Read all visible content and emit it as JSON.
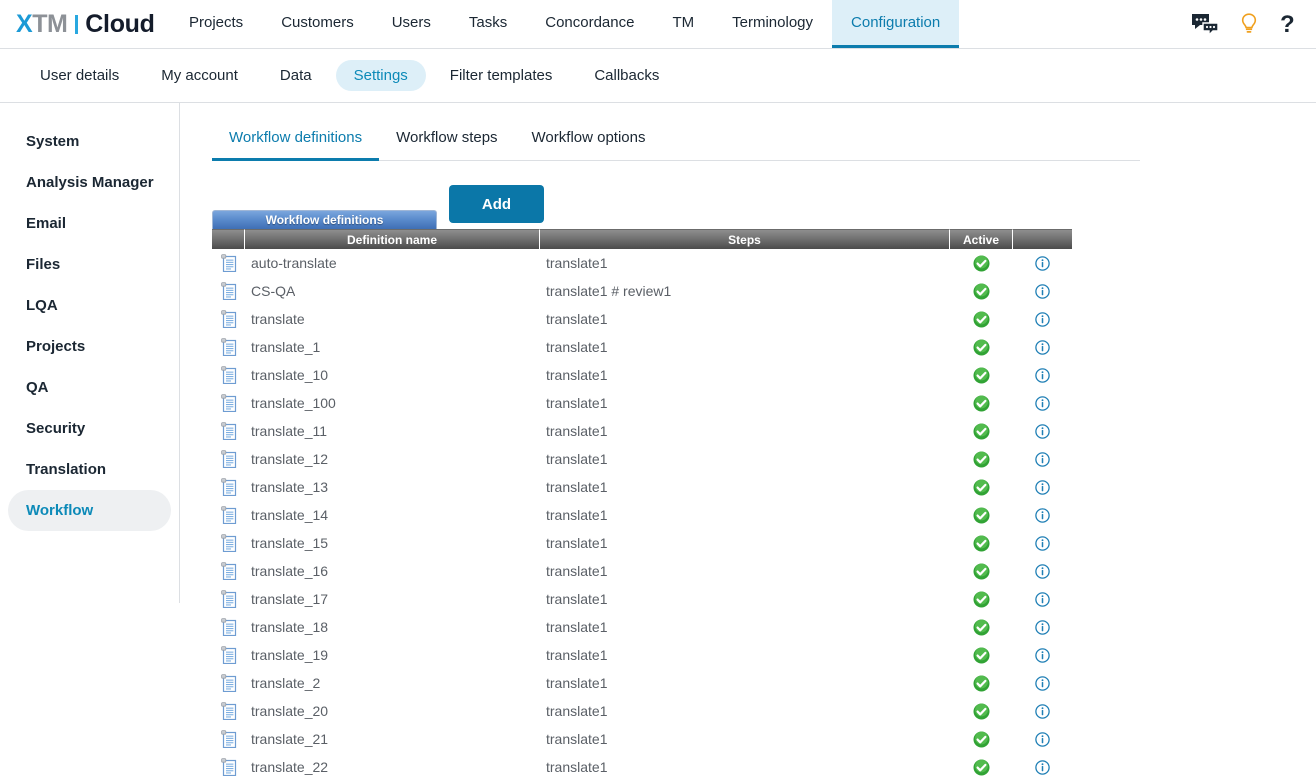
{
  "brand": {
    "x": "X",
    "tm": "TM",
    "cloud": "Cloud",
    "accent_blue": "#1c9ad6",
    "accent_teal": "#0c7cad"
  },
  "header": {
    "nav": [
      {
        "label": "Projects",
        "active": false
      },
      {
        "label": "Customers",
        "active": false
      },
      {
        "label": "Users",
        "active": false
      },
      {
        "label": "Tasks",
        "active": false
      },
      {
        "label": "Concordance",
        "active": false
      },
      {
        "label": "TM",
        "active": false
      },
      {
        "label": "Terminology",
        "active": false
      },
      {
        "label": "Configuration",
        "active": true
      }
    ],
    "icons": [
      {
        "name": "chat-icon",
        "glyph": "chat"
      },
      {
        "name": "lightbulb-icon",
        "glyph": "bulb"
      },
      {
        "name": "help-icon",
        "glyph": "?"
      }
    ]
  },
  "subnav": {
    "items": [
      {
        "label": "User details",
        "active": false
      },
      {
        "label": "My account",
        "active": false
      },
      {
        "label": "Data",
        "active": false
      },
      {
        "label": "Settings",
        "active": true
      },
      {
        "label": "Filter templates",
        "active": false
      },
      {
        "label": "Callbacks",
        "active": false
      }
    ]
  },
  "sidebar": {
    "items": [
      {
        "label": "System",
        "active": false
      },
      {
        "label": "Analysis Manager",
        "active": false
      },
      {
        "label": "Email",
        "active": false
      },
      {
        "label": "Files",
        "active": false
      },
      {
        "label": "LQA",
        "active": false
      },
      {
        "label": "Projects",
        "active": false
      },
      {
        "label": "QA",
        "active": false
      },
      {
        "label": "Security",
        "active": false
      },
      {
        "label": "Translation",
        "active": false
      },
      {
        "label": "Workflow",
        "active": true
      }
    ]
  },
  "content": {
    "tabs": [
      {
        "label": "Workflow definitions",
        "active": true
      },
      {
        "label": "Workflow steps",
        "active": false
      },
      {
        "label": "Workflow options",
        "active": false
      }
    ],
    "add_label": "Add",
    "panel_tab_label": "Workflow definitions",
    "table": {
      "columns": [
        "",
        "Definition name",
        "Steps",
        "Active",
        ""
      ],
      "rows": [
        {
          "name": "auto-translate",
          "steps": "translate1",
          "active": true
        },
        {
          "name": "CS-QA",
          "steps": "translate1 # review1",
          "active": true
        },
        {
          "name": "translate",
          "steps": "translate1",
          "active": true
        },
        {
          "name": "translate_1",
          "steps": "translate1",
          "active": true
        },
        {
          "name": "translate_10",
          "steps": "translate1",
          "active": true
        },
        {
          "name": "translate_100",
          "steps": "translate1",
          "active": true
        },
        {
          "name": "translate_11",
          "steps": "translate1",
          "active": true
        },
        {
          "name": "translate_12",
          "steps": "translate1",
          "active": true
        },
        {
          "name": "translate_13",
          "steps": "translate1",
          "active": true
        },
        {
          "name": "translate_14",
          "steps": "translate1",
          "active": true
        },
        {
          "name": "translate_15",
          "steps": "translate1",
          "active": true
        },
        {
          "name": "translate_16",
          "steps": "translate1",
          "active": true
        },
        {
          "name": "translate_17",
          "steps": "translate1",
          "active": true
        },
        {
          "name": "translate_18",
          "steps": "translate1",
          "active": true
        },
        {
          "name": "translate_19",
          "steps": "translate1",
          "active": true
        },
        {
          "name": "translate_2",
          "steps": "translate1",
          "active": true
        },
        {
          "name": "translate_20",
          "steps": "translate1",
          "active": true
        },
        {
          "name": "translate_21",
          "steps": "translate1",
          "active": true
        },
        {
          "name": "translate_22",
          "steps": "translate1",
          "active": true
        }
      ],
      "row_icon_name": "workflow-definition-icon",
      "active_icon_name": "active-check-icon",
      "info_icon_name": "info-icon"
    }
  }
}
